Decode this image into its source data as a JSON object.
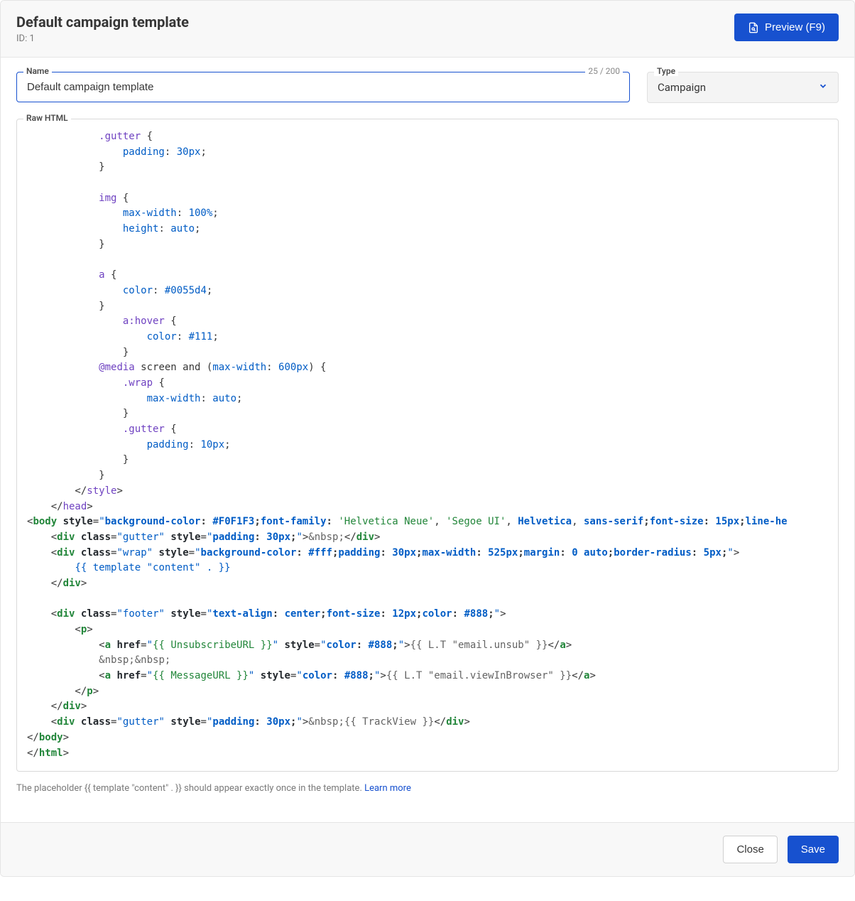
{
  "header": {
    "title": "Default campaign template",
    "id_label": "ID: 1",
    "preview_label": "Preview (F9)"
  },
  "form": {
    "name_label": "Name",
    "name_value": "Default campaign template",
    "name_counter": "25 / 200",
    "type_label": "Type",
    "type_value": "Campaign",
    "raw_label": "Raw HTML"
  },
  "code": {
    "l01_sel": ".gutter",
    "l02_prop": "padding",
    "l02_val": "30px",
    "l04_sel": "img",
    "l05_prop": "max-width",
    "l05_val": "100%",
    "l06_prop": "height",
    "l06_val": "auto",
    "l08_sel": "a",
    "l09_prop": "color",
    "l09_val": "#0055d4",
    "l11_sel": "a:hover",
    "l12_prop": "color",
    "l12_val": "#111",
    "l14_media": "@media",
    "l14_rest": " screen and (",
    "l14_mw": "max-width",
    "l14_mwv": "600px",
    "l14_close": ") {",
    "l15_sel": ".wrap",
    "l16_prop": "max-width",
    "l16_val": "auto",
    "l18_sel": ".gutter",
    "l19_prop": "padding",
    "l19_val": "10px",
    "l22_close_style": "style",
    "l23_close_head": "head",
    "l24_body": "body",
    "l24_style_attr": "style",
    "l24_bg": "background-color",
    "l24_bgv": "#F0F1F3",
    "l24_ff": "font-family",
    "l24_f1": "'Helvetica Neue'",
    "l24_f2": "'Segoe UI'",
    "l24_f3": "Helvetica",
    "l24_f4": "sans-serif",
    "l24_fs": "font-size",
    "l24_fsv": "15px",
    "l24_lh": "line-he",
    "l25_class": "class",
    "l25_cv": "gutter",
    "l25_style": "style",
    "l25_pad": "padding",
    "l25_padv": "30px",
    "l25_nbsp": "&nbsp;",
    "l26_class": "class",
    "l26_cv": "wrap",
    "l26_style": "style",
    "l26_bg": "background-color",
    "l26_bgv": "#fff",
    "l26_pad": "padding",
    "l26_padv": "30px",
    "l26_mw": "max-width",
    "l26_mwv": "525px",
    "l26_mg": "margin",
    "l26_mgv": "0 auto",
    "l26_br": "border-radius",
    "l26_brv": "5px",
    "l27_tpl": "{{ template \"content\" . }}",
    "l29_class": "class",
    "l29_cv": "footer",
    "l29_style": "style",
    "l29_ta": "text-align",
    "l29_tav": "center",
    "l29_fs": "font-size",
    "l29_fsv": "12px",
    "l29_col": "color",
    "l29_colv": "#888",
    "l31_href": "href",
    "l31_hv": "{{ UnsubscribeURL }}",
    "l31_style": "style",
    "l31_col": "color",
    "l31_colv": "#888",
    "l31_txt": "{{ L.T \"email.unsub\" }}",
    "l32_nbsp": "&nbsp;&nbsp;",
    "l33_href": "href",
    "l33_hv": "{{ MessageURL }}",
    "l33_style": "style",
    "l33_col": "color",
    "l33_colv": "#888",
    "l33_txt": "{{ L.T \"email.viewInBrowser\" }}",
    "l36_class": "class",
    "l36_cv": "gutter",
    "l36_style": "style",
    "l36_pad": "padding",
    "l36_padv": "30px",
    "l36_nbsp": "&nbsp;",
    "l36_tv": "{{ TrackView }}"
  },
  "helper": {
    "text": "The placeholder {{ template \"content\" . }} should appear exactly once in the template. ",
    "link": "Learn more"
  },
  "footer": {
    "close": "Close",
    "save": "Save"
  }
}
